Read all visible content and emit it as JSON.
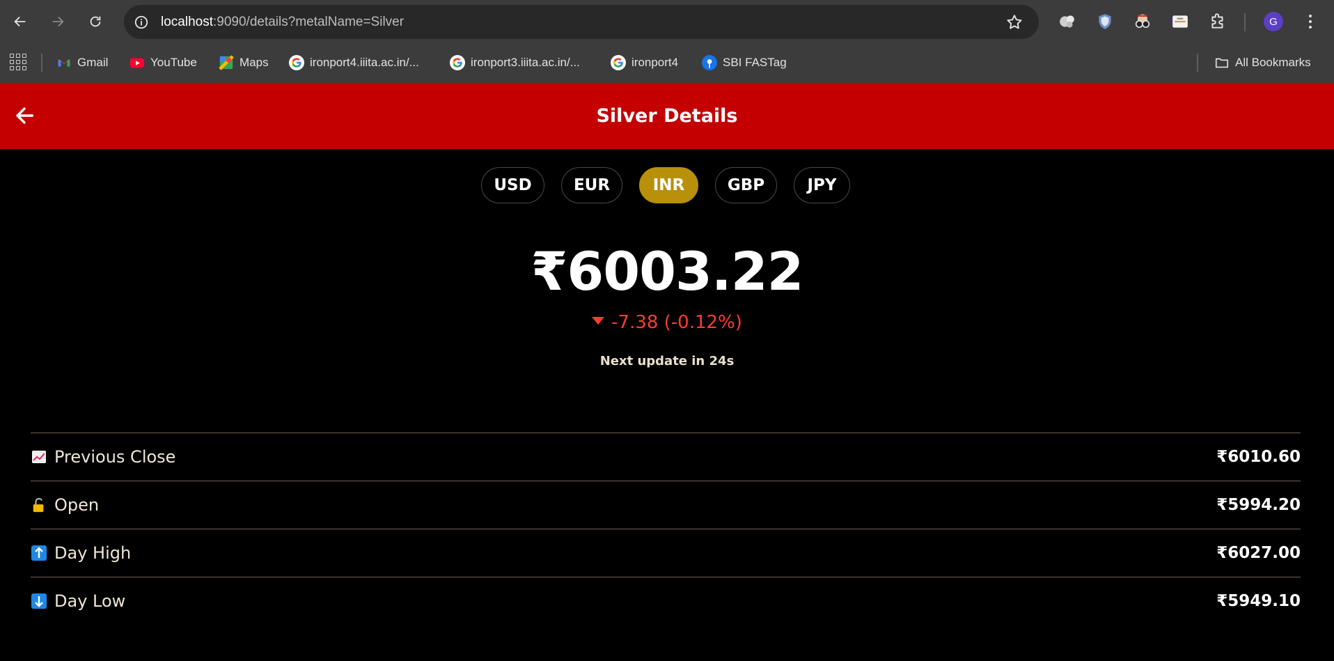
{
  "browser": {
    "url_host": "localhost",
    "url_rest": ":9090/details?metalName=Silver",
    "avatar_letter": "G",
    "bookmarks": [
      {
        "label": "Gmail",
        "icon": "gmail-icon"
      },
      {
        "label": "YouTube",
        "icon": "youtube-icon"
      },
      {
        "label": "Maps",
        "icon": "maps-icon"
      },
      {
        "label": "ironport4.iiita.ac.in/...",
        "icon": "google-icon"
      },
      {
        "label": "ironport3.iiita.ac.in/...",
        "icon": "google-icon"
      },
      {
        "label": "ironport4",
        "icon": "google-icon"
      },
      {
        "label": "SBI FASTag",
        "icon": "sbi-icon"
      }
    ],
    "all_bookmarks_label": "All Bookmarks"
  },
  "header": {
    "title": "Silver Details",
    "color": "#c40000"
  },
  "currencies": [
    {
      "code": "USD",
      "active": false
    },
    {
      "code": "EUR",
      "active": false
    },
    {
      "code": "INR",
      "active": true
    },
    {
      "code": "GBP",
      "active": false
    },
    {
      "code": "JPY",
      "active": false
    }
  ],
  "price": {
    "current": "₹6003.22",
    "change": "-7.38 (-0.12%)",
    "direction": "down",
    "change_color": "#ff3b30",
    "next_update": "Next update in 24s"
  },
  "stats": [
    {
      "label": "Previous Close",
      "icon": "chart-increasing-icon",
      "value": "₹6010.60"
    },
    {
      "label": "Open",
      "icon": "unlocked-icon",
      "value": "₹5994.20"
    },
    {
      "label": "Day High",
      "icon": "up-arrow-icon",
      "value": "₹6027.00"
    },
    {
      "label": "Day Low",
      "icon": "down-arrow-icon",
      "value": "₹5949.10"
    }
  ],
  "accent_color": "#b8900a"
}
